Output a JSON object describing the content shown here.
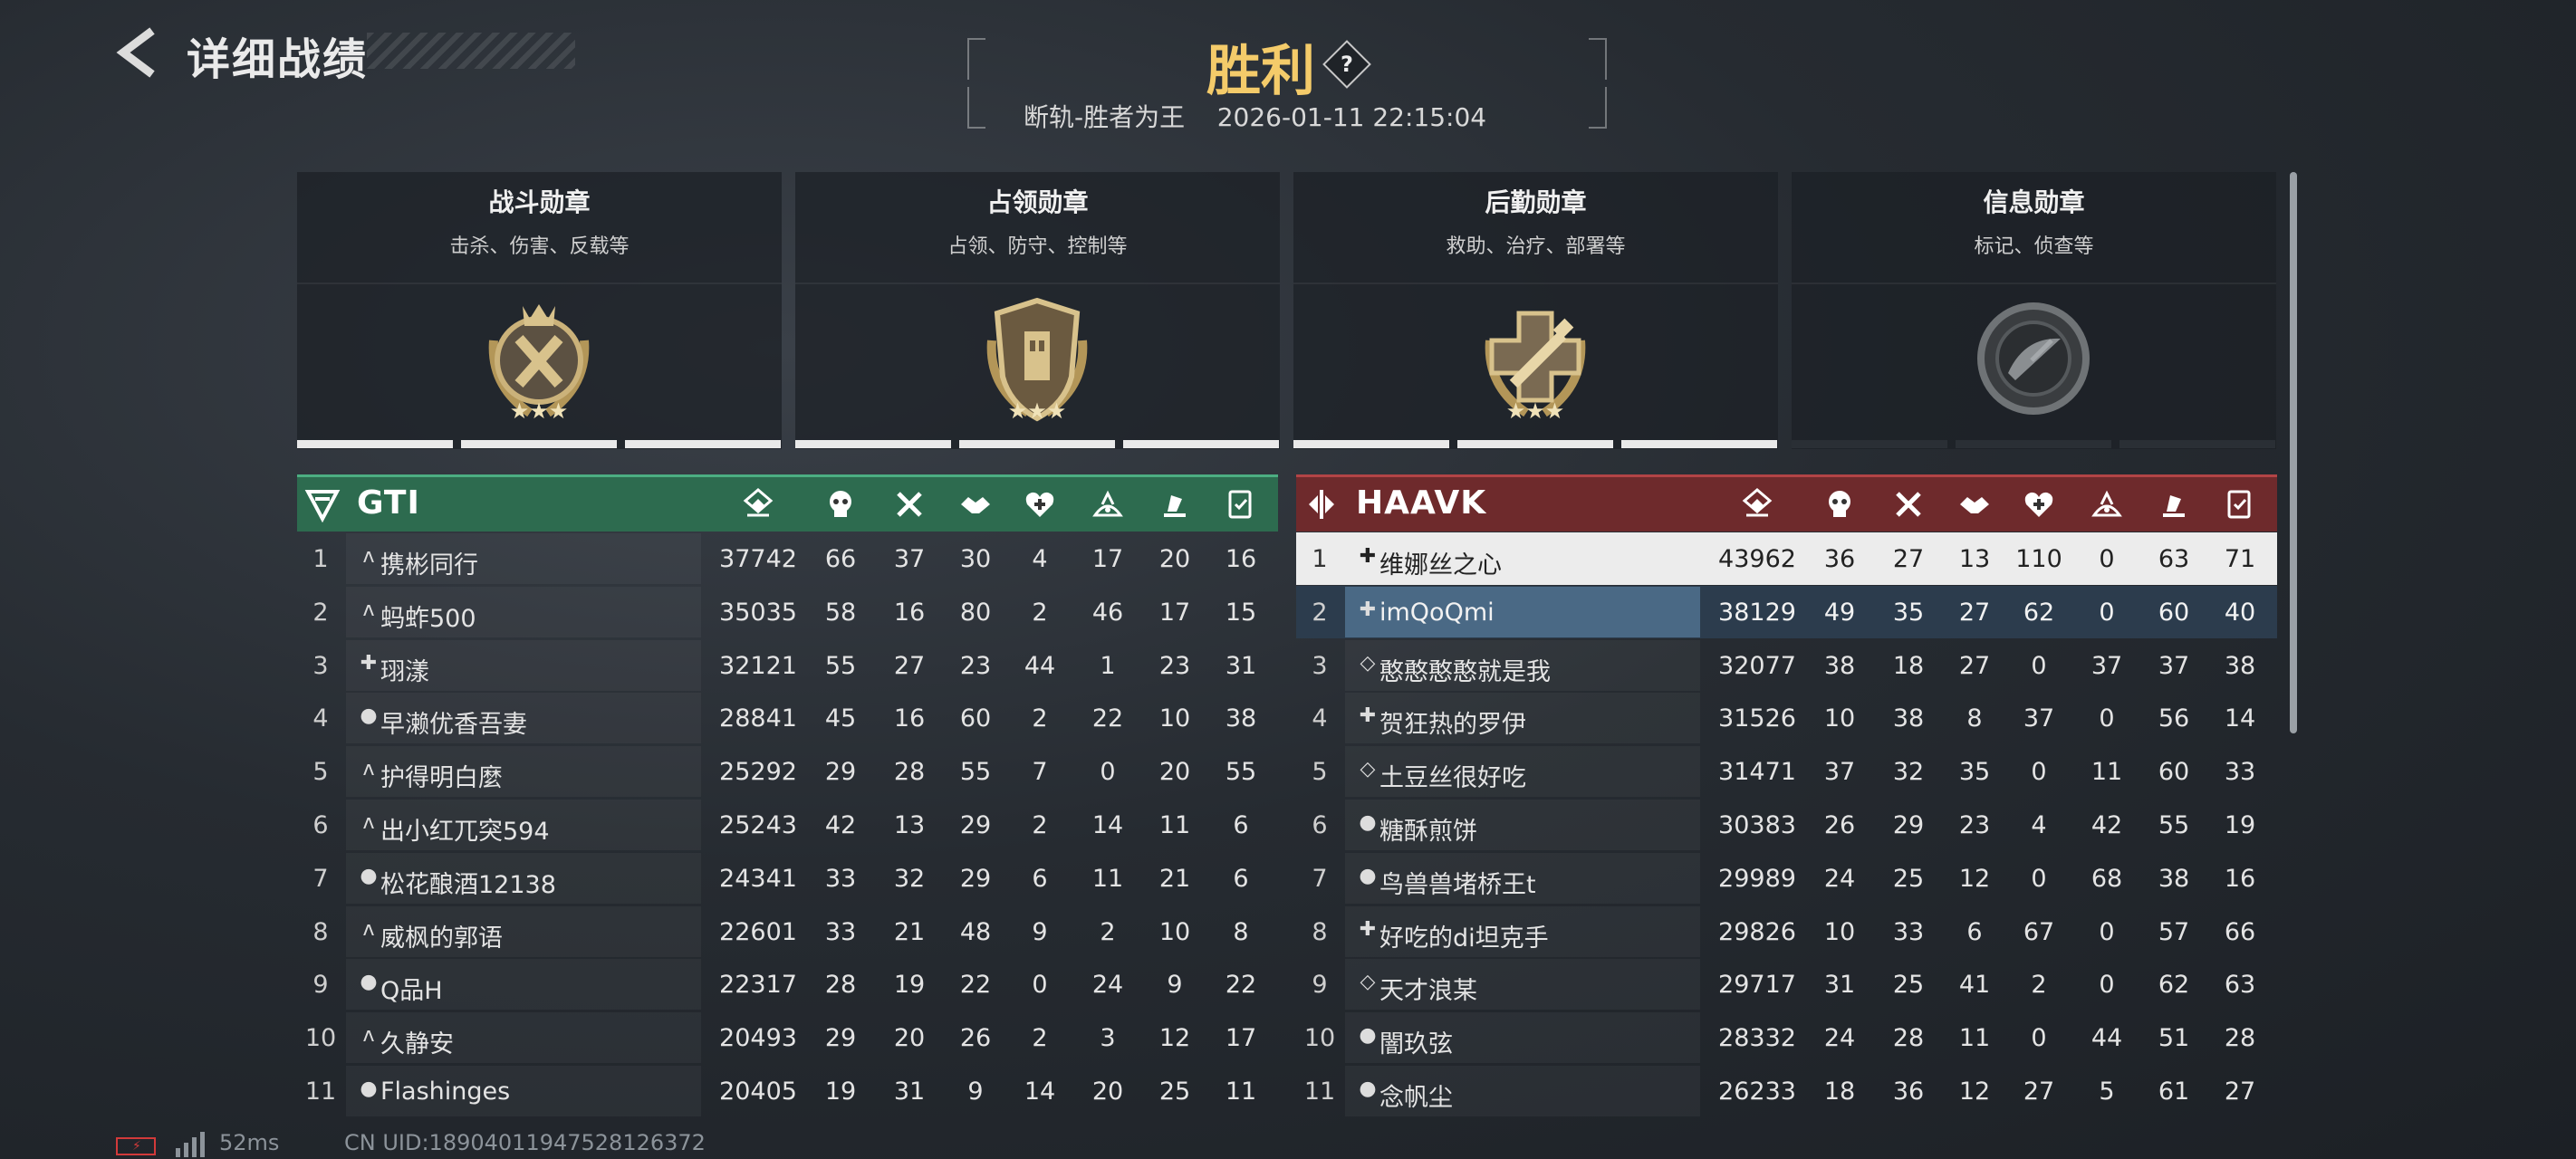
{
  "header": {
    "title": "详细战绩",
    "result": "胜利",
    "help": "?",
    "map_mode": "断轨-胜者为王",
    "datetime": "2026-01-11 22:15:04"
  },
  "medals": [
    {
      "title": "战斗勋章",
      "desc": "击杀、伤害、反载等",
      "icon": "combat-medal-icon",
      "bars_filled": 3
    },
    {
      "title": "占领勋章",
      "desc": "占领、防守、控制等",
      "icon": "capture-medal-icon",
      "bars_filled": 3
    },
    {
      "title": "后勤勋章",
      "desc": "救助、治疗、部署等",
      "icon": "logistics-medal-icon",
      "bars_filled": 3
    },
    {
      "title": "信息勋章",
      "desc": "标记、侦查等",
      "icon": "intel-medal-icon",
      "bars_filled": 0
    }
  ],
  "stat_columns": [
    "score-icon",
    "kills-icon",
    "deaths-icon",
    "assists-icon",
    "revive-icon",
    "capture-icon",
    "vehicle-icon",
    "support-icon"
  ],
  "teams": [
    {
      "name": "GTI",
      "color": "#2d6b4f",
      "players": [
        {
          "rank": "1",
          "icon": "assault",
          "name": "携彬同行",
          "stats": [
            "37742",
            "66",
            "37",
            "30",
            "4",
            "17",
            "20",
            "16"
          ]
        },
        {
          "rank": "2",
          "icon": "assault",
          "name": "蚂蚱500",
          "stats": [
            "35035",
            "58",
            "16",
            "80",
            "2",
            "46",
            "17",
            "15"
          ]
        },
        {
          "rank": "3",
          "icon": "medic",
          "name": "珝漾",
          "stats": [
            "32121",
            "55",
            "27",
            "23",
            "44",
            "1",
            "23",
            "31"
          ]
        },
        {
          "rank": "4",
          "icon": "support",
          "name": "早濑优香吾妻",
          "stats": [
            "28841",
            "45",
            "16",
            "60",
            "2",
            "22",
            "10",
            "38"
          ]
        },
        {
          "rank": "5",
          "icon": "assault",
          "name": "护得明白麼",
          "stats": [
            "25292",
            "29",
            "28",
            "55",
            "7",
            "0",
            "20",
            "55"
          ]
        },
        {
          "rank": "6",
          "icon": "assault",
          "name": "出小红兀突594",
          "stats": [
            "25243",
            "42",
            "13",
            "29",
            "2",
            "14",
            "11",
            "6"
          ]
        },
        {
          "rank": "7",
          "icon": "support",
          "name": "松花酿酒12138",
          "stats": [
            "24341",
            "33",
            "32",
            "29",
            "6",
            "11",
            "21",
            "6"
          ]
        },
        {
          "rank": "8",
          "icon": "assault",
          "name": "威枫的郭语",
          "stats": [
            "22601",
            "33",
            "21",
            "48",
            "9",
            "2",
            "10",
            "8"
          ]
        },
        {
          "rank": "9",
          "icon": "support",
          "name": "Q品H",
          "stats": [
            "22317",
            "28",
            "19",
            "22",
            "0",
            "24",
            "9",
            "22"
          ]
        },
        {
          "rank": "10",
          "icon": "assault",
          "name": "久静安",
          "stats": [
            "20493",
            "29",
            "20",
            "26",
            "2",
            "3",
            "12",
            "17"
          ]
        },
        {
          "rank": "11",
          "icon": "support",
          "name": "Flashinges",
          "stats": [
            "20405",
            "19",
            "31",
            "9",
            "14",
            "20",
            "25",
            "11"
          ]
        }
      ]
    },
    {
      "name": "HAAVK",
      "color": "#6e2a2c",
      "players": [
        {
          "rank": "1",
          "icon": "medic",
          "name": "维娜丝之心",
          "stats": [
            "43962",
            "36",
            "27",
            "13",
            "110",
            "0",
            "63",
            "71"
          ]
        },
        {
          "rank": "2",
          "icon": "medic",
          "name": "imQoQmi",
          "stats": [
            "38129",
            "49",
            "35",
            "27",
            "62",
            "0",
            "60",
            "40"
          ]
        },
        {
          "rank": "3",
          "icon": "recon",
          "name": "憨憨憨憨就是我",
          "stats": [
            "32077",
            "38",
            "18",
            "27",
            "0",
            "37",
            "37",
            "38"
          ]
        },
        {
          "rank": "4",
          "icon": "medic",
          "name": "贺狂热的罗伊",
          "stats": [
            "31526",
            "10",
            "38",
            "8",
            "37",
            "0",
            "56",
            "14"
          ]
        },
        {
          "rank": "5",
          "icon": "recon",
          "name": "土豆丝很好吃",
          "stats": [
            "31471",
            "37",
            "32",
            "35",
            "0",
            "11",
            "60",
            "33"
          ]
        },
        {
          "rank": "6",
          "icon": "support",
          "name": "糖酥煎饼",
          "stats": [
            "30383",
            "26",
            "29",
            "23",
            "4",
            "42",
            "55",
            "19"
          ]
        },
        {
          "rank": "7",
          "icon": "support",
          "name": "鸟兽兽堵桥王t",
          "stats": [
            "29989",
            "24",
            "25",
            "12",
            "0",
            "68",
            "38",
            "16"
          ]
        },
        {
          "rank": "8",
          "icon": "medic",
          "name": "好吃的di坦克手",
          "stats": [
            "29826",
            "10",
            "33",
            "6",
            "67",
            "0",
            "57",
            "66"
          ]
        },
        {
          "rank": "9",
          "icon": "recon",
          "name": "天才浪某",
          "stats": [
            "29717",
            "31",
            "25",
            "41",
            "2",
            "0",
            "62",
            "63"
          ]
        },
        {
          "rank": "10",
          "icon": "support",
          "name": "闇玖弦",
          "stats": [
            "28332",
            "24",
            "28",
            "11",
            "0",
            "44",
            "51",
            "28"
          ]
        },
        {
          "rank": "11",
          "icon": "support",
          "name": "念帆尘",
          "stats": [
            "26233",
            "18",
            "36",
            "12",
            "27",
            "5",
            "61",
            "27"
          ]
        }
      ]
    }
  ],
  "footer": {
    "ping": "52ms",
    "uid": "CN UID:1890401194752812637​2"
  },
  "colors": {
    "gold": "#f4cb6a",
    "gti": "#2d6b4f",
    "haavk": "#6e2a2c"
  }
}
